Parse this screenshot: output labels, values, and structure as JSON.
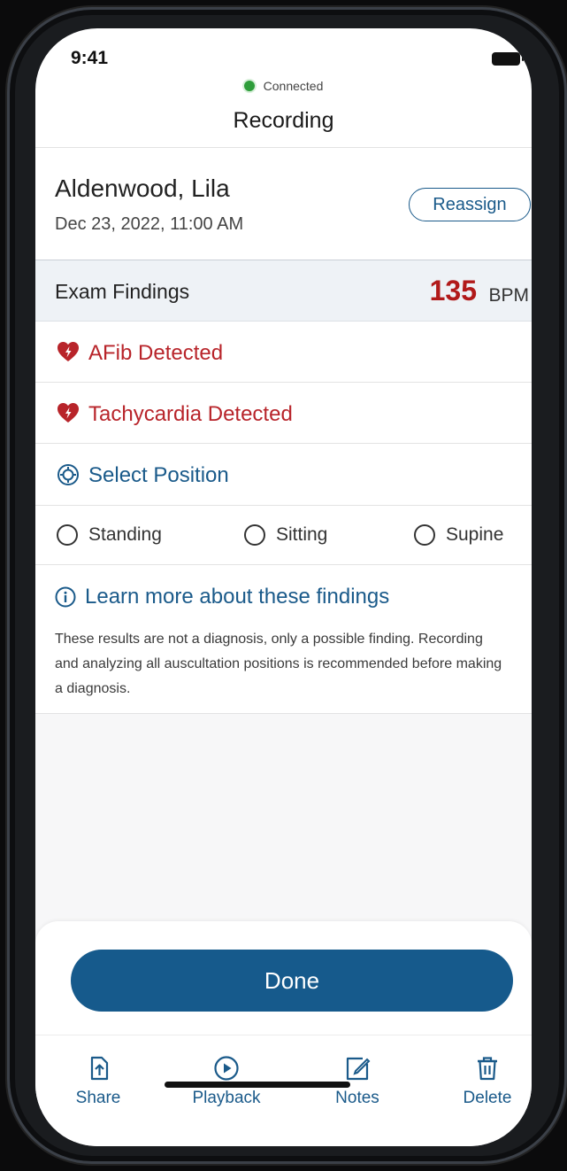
{
  "status_bar": {
    "time": "9:41"
  },
  "connection": {
    "status": "Connected",
    "status_color": "#2e9d3a"
  },
  "nav": {
    "title": "Recording"
  },
  "patient": {
    "name": "Aldenwood, Lila",
    "datetime": "Dec 23, 2022, 11:00 AM",
    "reassign_label": "Reassign"
  },
  "findings": {
    "title": "Exam Findings",
    "bpm_value": "135",
    "bpm_unit": "BPM",
    "items": [
      {
        "label": "AFib Detected",
        "icon": "heart-alert-icon",
        "color": "#b8242a"
      },
      {
        "label": "Tachycardia Detected",
        "icon": "heart-alert-icon",
        "color": "#b8242a"
      }
    ]
  },
  "position": {
    "label": "Select Position",
    "icon": "target-icon",
    "options": [
      "Standing",
      "Sitting",
      "Supine"
    ],
    "selected": null
  },
  "learn_more": {
    "label": "Learn more about these findings",
    "icon": "info-icon",
    "disclaimer": "These results are not a diagnosis, only a possible finding. Recording and analyzing all auscultation positions is recommended before making a diagnosis."
  },
  "actions": {
    "done_label": "Done",
    "accent": "#165a8c",
    "tabs": [
      {
        "label": "Share",
        "icon": "share-icon"
      },
      {
        "label": "Playback",
        "icon": "play-icon"
      },
      {
        "label": "Notes",
        "icon": "notes-icon"
      },
      {
        "label": "Delete",
        "icon": "trash-icon"
      }
    ]
  }
}
